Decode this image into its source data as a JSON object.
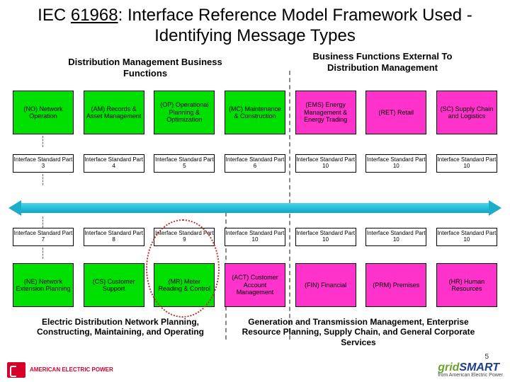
{
  "title_a": "IEC ",
  "title_u": "61968",
  "title_b": ": Interface Reference Model Framework Used - Identifying Message Types",
  "sect_top_left": "Distribution Management Business Functions",
  "sect_top_right": "Business Functions External To Distribution Management",
  "sect_bot_left": "Electric Distribution Network Planning, Constructing, Maintaining, and Operating",
  "sect_bot_right": "Generation and Transmission Management, Enterprise Resource Planning, Supply Chain, and General Corporate Services",
  "top": [
    {
      "c": "green",
      "t": "(NO) Network Operation"
    },
    {
      "c": "green",
      "t": "(AM) Records & Asset Management"
    },
    {
      "c": "green",
      "t": "(OP) Operational Planning & Optimization"
    },
    {
      "c": "green",
      "t": "(MC) Maintenance & Construction"
    },
    {
      "c": "mag",
      "t": "(EMS) Energy Management & Energy Trading"
    },
    {
      "c": "mag",
      "t": "(RET) Retail"
    },
    {
      "c": "mag",
      "t": "(SC) Supply Chain and Logistics"
    }
  ],
  "if_top": [
    "Interface Standard Part 3",
    "Interface Standard Part 4",
    "Interface Standard Part 5",
    "Interface Standard Part 6",
    "Interface Standard Part 10",
    "Interface Standard Part 10",
    "Interface Standard Part 10"
  ],
  "if_bot": [
    "Interface Standard Part 7",
    "Interface Standard Part 8",
    "Interface Standard Part 9",
    "Interface Standard Part 10",
    "Interface Standard Part 10",
    "Interface Standard Part 10",
    "Interface Standard Part 10"
  ],
  "bot": [
    {
      "c": "green",
      "t": "(NE) Network Extension Planning"
    },
    {
      "c": "green",
      "t": "(CS) Customer Support"
    },
    {
      "c": "green",
      "t": "(MR) Meter Reading & Control"
    },
    {
      "c": "mag",
      "t": "(ACT) Customer Account Management"
    },
    {
      "c": "mag",
      "t": "(FIN) Financial"
    },
    {
      "c": "mag",
      "t": "(PRM) Premises"
    },
    {
      "c": "mag",
      "t": "(HR) Human Resources"
    }
  ],
  "aep": "AMERICAN ELECTRIC POWER",
  "grid_g": "grid",
  "grid_s": "SMART",
  "grid_sub": "from American Electric Power",
  "page_num": "5"
}
